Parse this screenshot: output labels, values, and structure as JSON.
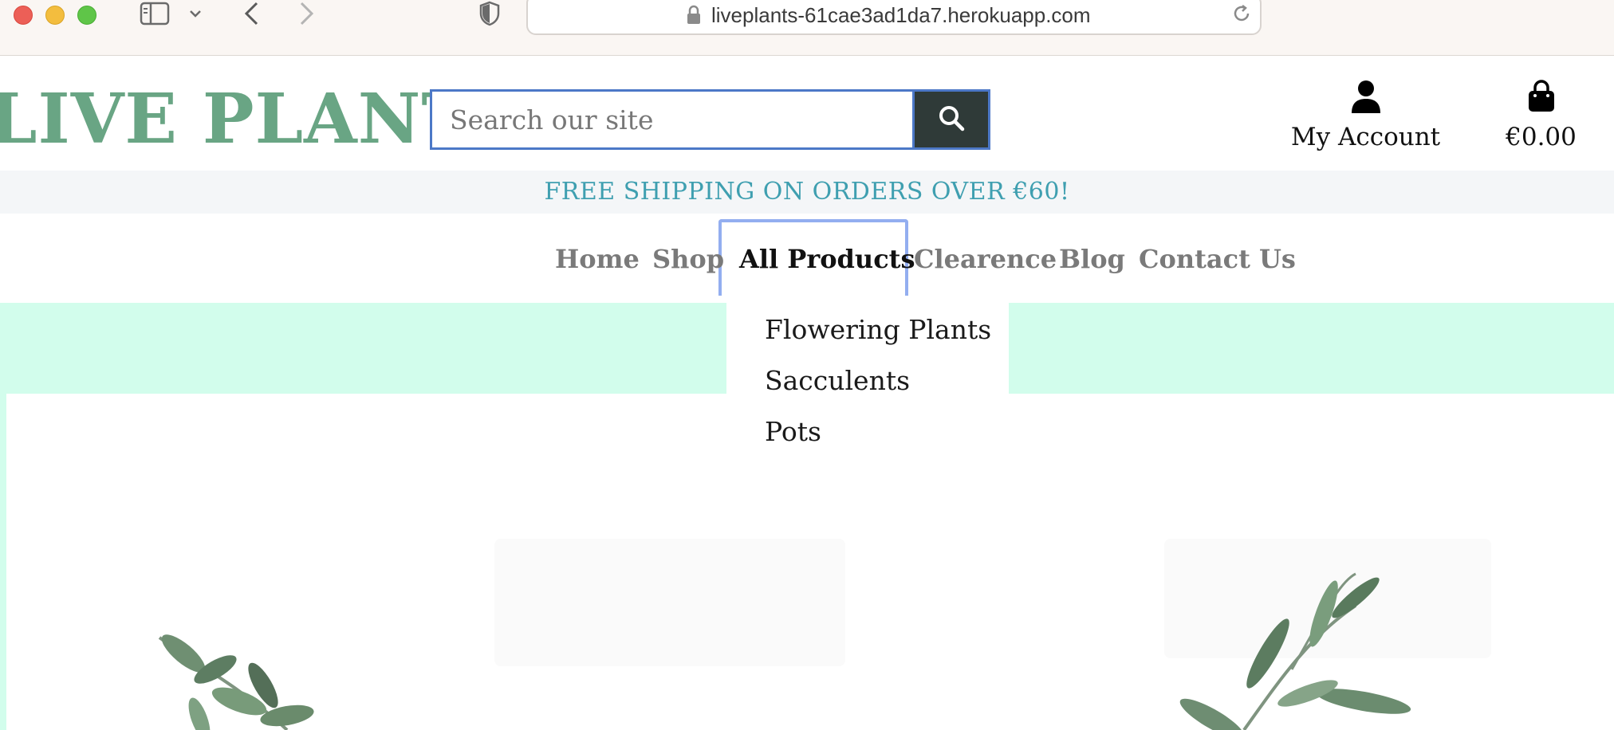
{
  "browser": {
    "url": "liveplants-61cae3ad1da7.herokuapp.com"
  },
  "header": {
    "logo": "LIVE PLANTS",
    "search_placeholder": "Search our site",
    "account_label": "My Account",
    "cart_total": "€0.00"
  },
  "banner": {
    "text": "FREE SHIPPING ON ORDERS OVER €60!"
  },
  "nav": {
    "items": [
      {
        "label": "Home"
      },
      {
        "label": "Shop"
      },
      {
        "label": "All Products"
      },
      {
        "label": "Clearence"
      },
      {
        "label": "Blog"
      },
      {
        "label": "Contact Us"
      }
    ],
    "dropdown": [
      {
        "label": "Flowering Plants"
      },
      {
        "label": "Sacculents"
      },
      {
        "label": "Pots"
      }
    ]
  },
  "icons": {
    "search": "search-icon",
    "account": "user-icon",
    "cart": "shopping-bag-icon"
  },
  "colors": {
    "logo": "#69a584",
    "banner_text": "#3f9fb0",
    "hero_band": "#d2fdec",
    "search_button": "#2f3a38",
    "nav_focus": "#93aef0"
  }
}
